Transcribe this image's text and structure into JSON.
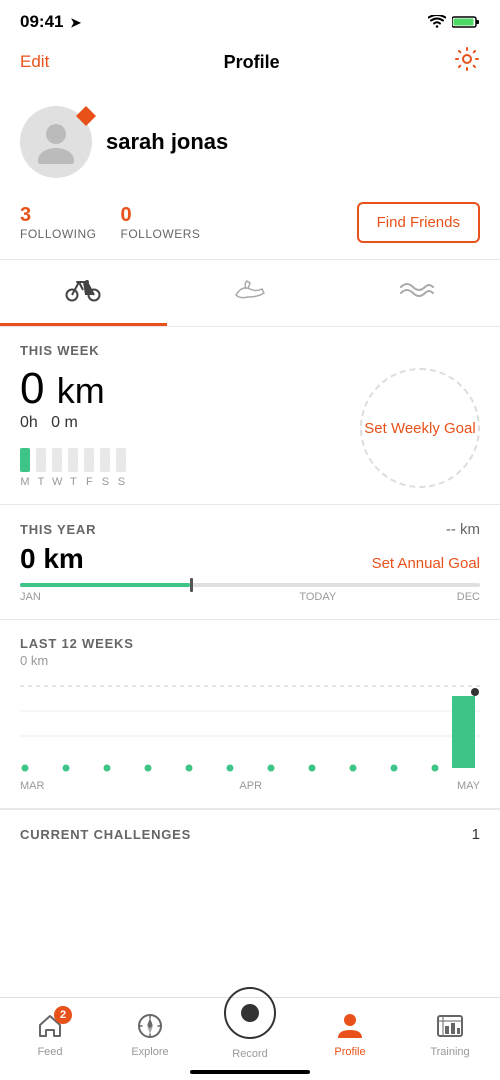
{
  "statusBar": {
    "time": "09:41",
    "locationArrow": "➤"
  },
  "header": {
    "editLabel": "Edit",
    "title": "Profile",
    "gearIcon": "⚙"
  },
  "profile": {
    "username": "sarah jonas",
    "badgeIcon": "◆"
  },
  "stats": {
    "following": "3",
    "followingLabel": "FOLLOWING",
    "followers": "0",
    "followersLabel": "FOLLOWERS",
    "findFriendsLabel": "Find Friends"
  },
  "tabs": [
    {
      "id": "bike",
      "icon": "🚲",
      "active": true
    },
    {
      "id": "run",
      "icon": "👟",
      "active": false
    },
    {
      "id": "swim",
      "icon": "〜",
      "active": false
    }
  ],
  "thisWeek": {
    "label": "THIS WEEK",
    "distance": "0",
    "unit": "km",
    "hours": "0h",
    "minutes": "0 m",
    "days": [
      "M",
      "T",
      "W",
      "T",
      "F",
      "S",
      "S"
    ],
    "activeDay": 0,
    "goalText": "Set Weekly Goal"
  },
  "thisYear": {
    "label": "THIS YEAR",
    "kmLabel": "-- km",
    "distance": "0 km",
    "goalLabel": "Set Annual Goal",
    "progressStart": "JAN",
    "progressMiddle": "TODAY",
    "progressEnd": "DEC"
  },
  "last12Weeks": {
    "label": "LAST 12 WEEKS",
    "kmValue": "0 km",
    "chartLabels": [
      "MAR",
      "APR",
      "MAY"
    ],
    "chartData": [
      0,
      0,
      0,
      0,
      0,
      0,
      0,
      0,
      0,
      0,
      0,
      85
    ]
  },
  "currentChallenges": {
    "label": "CURRENT CHALLENGES",
    "count": "1"
  },
  "bottomNav": [
    {
      "id": "feed",
      "label": "Feed",
      "icon": "house",
      "badge": "2",
      "active": false
    },
    {
      "id": "explore",
      "label": "Explore",
      "icon": "compass",
      "badge": "",
      "active": false
    },
    {
      "id": "record",
      "label": "Record",
      "icon": "record",
      "badge": "",
      "active": false
    },
    {
      "id": "profile",
      "label": "Profile",
      "icon": "person",
      "badge": "",
      "active": true
    },
    {
      "id": "training",
      "label": "Training",
      "icon": "chart",
      "badge": "",
      "active": false
    }
  ]
}
